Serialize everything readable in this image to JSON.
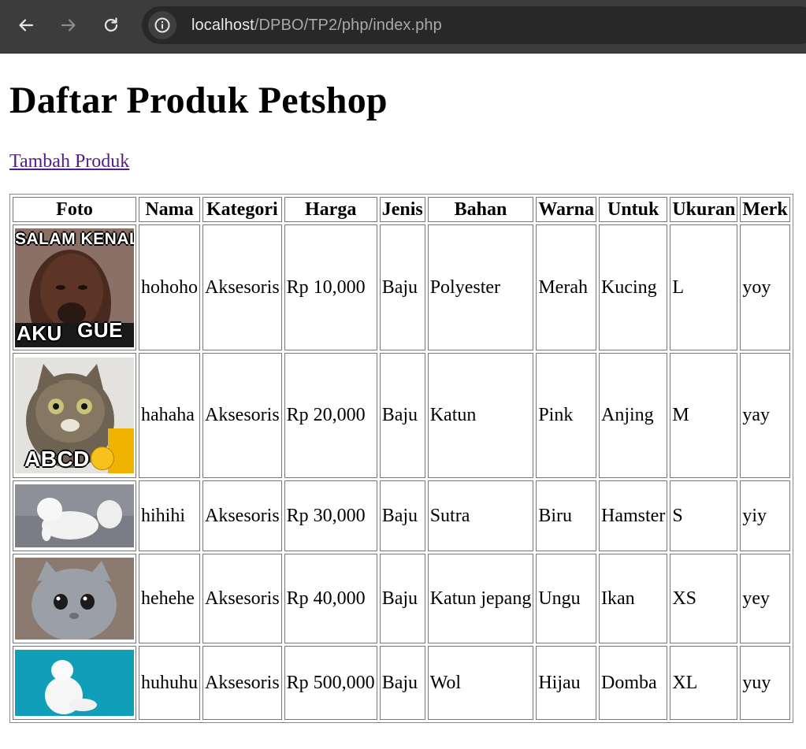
{
  "browser": {
    "url_host": "localhost",
    "url_path": "/DPBO/TP2/php/index.php",
    "back_icon": "arrow-left-icon",
    "forward_icon": "arrow-right-icon",
    "reload_icon": "reload-icon",
    "info_icon": "info-icon"
  },
  "page": {
    "title": "Daftar Produk Petshop",
    "add_link": "Tambah Produk"
  },
  "table": {
    "headers": [
      "Foto",
      "Nama",
      "Kategori",
      "Harga",
      "Jenis",
      "Bahan",
      "Warna",
      "Untuk",
      "Ukuran",
      "Merk"
    ],
    "rows": [
      {
        "photo_top": "SALAM KENAL",
        "photo_bottom_left": "AKU",
        "photo_bottom_right": "GUE",
        "nama": "hohoho",
        "kategori": "Aksesoris",
        "harga": "Rp 10,000",
        "jenis": "Baju",
        "bahan": "Polyester",
        "warna": "Merah",
        "untuk": "Kucing",
        "ukuran": "L",
        "merk": "yoy"
      },
      {
        "photo_bottom": "ABCD",
        "nama": "hahaha",
        "kategori": "Aksesoris",
        "harga": "Rp 20,000",
        "jenis": "Baju",
        "bahan": "Katun",
        "warna": "Pink",
        "untuk": "Anjing",
        "ukuran": "M",
        "merk": "yay"
      },
      {
        "nama": "hihihi",
        "kategori": "Aksesoris",
        "harga": "Rp 30,000",
        "jenis": "Baju",
        "bahan": "Sutra",
        "warna": "Biru",
        "untuk": "Hamster",
        "ukuran": "S",
        "merk": "yiy"
      },
      {
        "nama": "hehehe",
        "kategori": "Aksesoris",
        "harga": "Rp 40,000",
        "jenis": "Baju",
        "bahan": "Katun jepang",
        "warna": "Ungu",
        "untuk": "Ikan",
        "ukuran": "XS",
        "merk": "yey"
      },
      {
        "nama": "huhuhu",
        "kategori": "Aksesoris",
        "harga": "Rp 500,000",
        "jenis": "Baju",
        "bahan": "Wol",
        "warna": "Hijau",
        "untuk": "Domba",
        "ukuran": "XL",
        "merk": "yuy"
      }
    ]
  }
}
